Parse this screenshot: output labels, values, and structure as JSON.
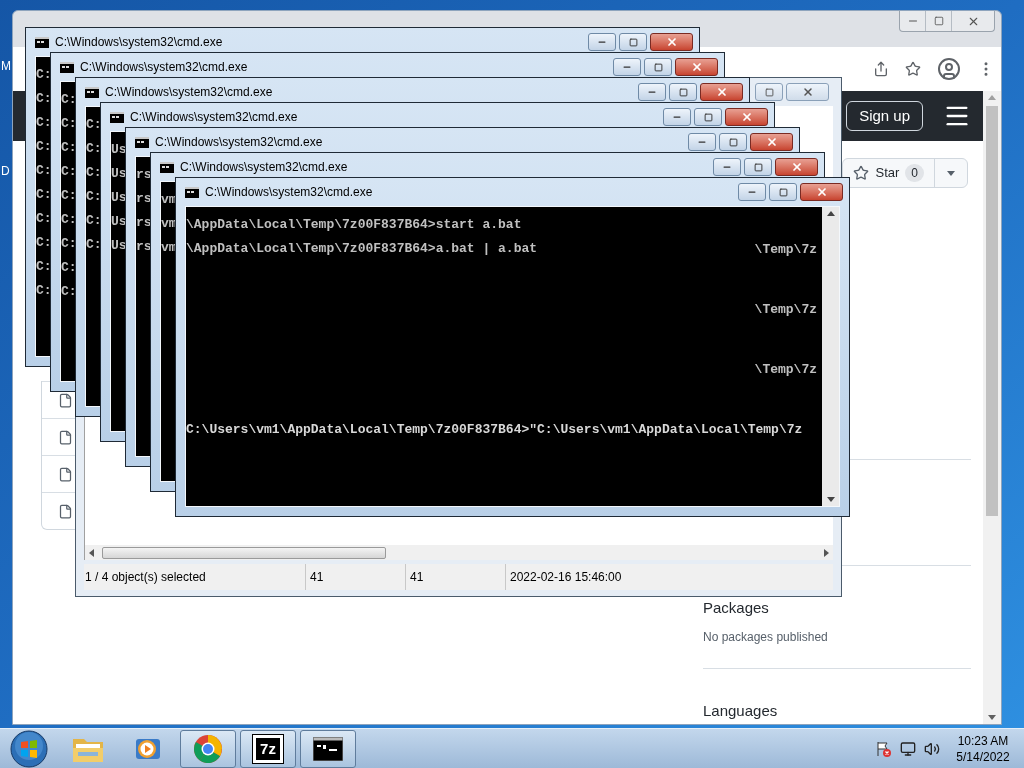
{
  "desktop_labels": [
    "M",
    "D"
  ],
  "browser": {
    "signup": "Sign up",
    "star": {
      "label": "Star",
      "count": "0"
    },
    "sidebar": [
      {
        "heading": "Packages",
        "text": "No packages published"
      },
      {
        "heading": "Languages"
      }
    ]
  },
  "archive_window": {
    "status": [
      "1 / 4 object(s) selected",
      "41",
      "41",
      "2022-02-16 15:46:00"
    ]
  },
  "consoles": [
    {
      "title": "C:\\Windows\\system32\\cmd.exe",
      "lines": [
        "C:",
        "C:",
        "C:",
        "C:",
        "C:",
        "C:",
        "C:",
        "C:",
        "C:",
        "C:"
      ]
    },
    {
      "title": "C:\\Windows\\system32\\cmd.exe",
      "lines": [
        "C:",
        "C:",
        "C:",
        "C:",
        "C:",
        "C:",
        "C:",
        "C:",
        "C:"
      ]
    },
    {
      "title": "C:\\Windows\\system32\\cmd.exe",
      "lines": [
        "C:",
        "C:",
        "C:",
        "C:",
        "C:",
        "C:"
      ]
    },
    {
      "title": "C:\\Windows\\system32\\cmd.exe",
      "lines": [
        "Us",
        "Us",
        "Us",
        "Us",
        "Us"
      ]
    },
    {
      "title": "C:\\Windows\\system32\\cmd.exe",
      "lines": [
        "rs",
        "rs",
        "rs",
        "rs"
      ]
    },
    {
      "title": "C:\\Windows\\system32\\cmd.exe",
      "lines": [
        "vm",
        "vm",
        "vm"
      ]
    },
    {
      "title": "C:\\Windows\\system32\\cmd.exe",
      "lines": [
        "\\AppData\\Local\\Temp\\7z00F837B64>start a.bat",
        "\\AppData\\Local\\Temp\\7z00F837B64>a.bat | a.bat"
      ],
      "fragments": [
        "\\Temp\\7z",
        "\\Temp\\7z",
        "\\Temp\\7z"
      ],
      "overlay": "C:\\Users\\vm1\\AppData\\Local\\Temp\\7z00F837B64>\"C:\\Users\\vm1\\AppData\\Local\\Temp\\7z"
    }
  ],
  "taskbar": {
    "apps": [
      {
        "kind": "folder",
        "running": false
      },
      {
        "kind": "media",
        "running": false
      },
      {
        "kind": "browser",
        "running": true
      },
      {
        "kind": "archiver",
        "running": true,
        "label": "7z"
      },
      {
        "kind": "console",
        "running": true
      }
    ],
    "clock": {
      "time": "10:23 AM",
      "date": "5/14/2022"
    }
  }
}
